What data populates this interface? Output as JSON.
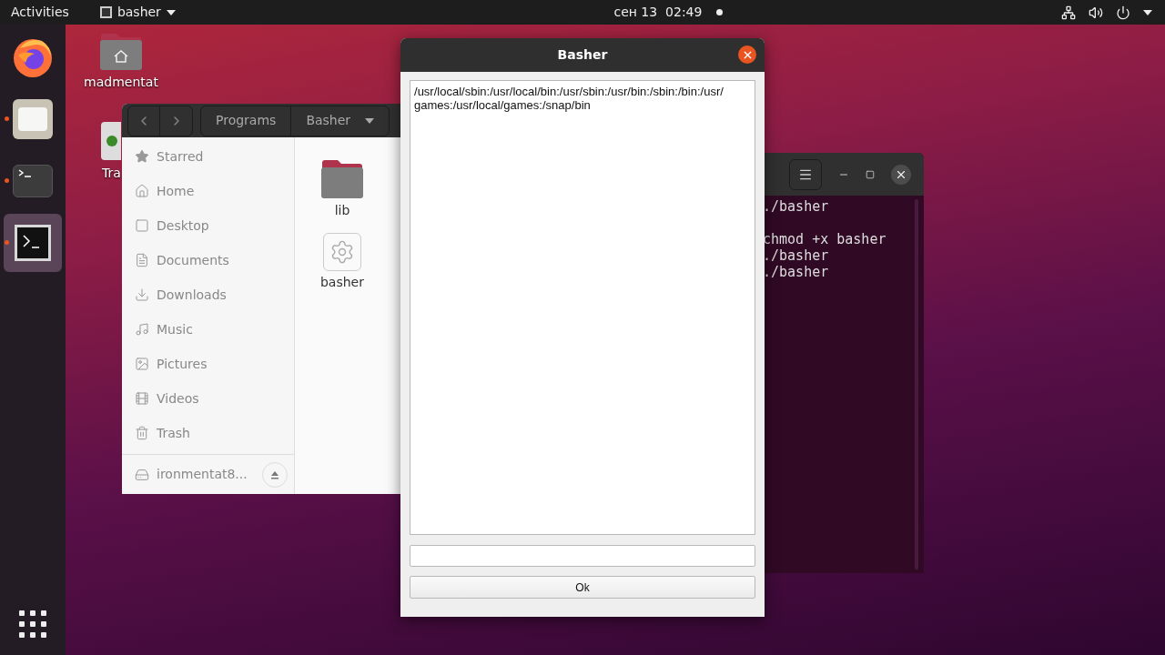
{
  "top_bar": {
    "activities": "Activities",
    "app_menu": "basher",
    "clock": "сен 13  02:49",
    "notification_dot": true
  },
  "dock": {
    "items": [
      {
        "kind": "firefox",
        "running": false,
        "active": false
      },
      {
        "kind": "files",
        "running": true,
        "active": false
      },
      {
        "kind": "terminal",
        "running": true,
        "active": false
      },
      {
        "kind": "console",
        "running": true,
        "active": true
      }
    ]
  },
  "desktop_icons": [
    {
      "kind": "home",
      "label": "madmentat"
    },
    {
      "kind": "trash",
      "label": "Tra"
    }
  ],
  "file_manager": {
    "path": [
      "Programs",
      "Basher"
    ],
    "sidebar": [
      {
        "kind": "star",
        "label": "Starred"
      },
      {
        "kind": "home",
        "label": "Home"
      },
      {
        "kind": "desktop",
        "label": "Desktop"
      },
      {
        "kind": "documents",
        "label": "Documents"
      },
      {
        "kind": "downloads",
        "label": "Downloads"
      },
      {
        "kind": "music",
        "label": "Music"
      },
      {
        "kind": "pictures",
        "label": "Pictures"
      },
      {
        "kind": "videos",
        "label": "Videos"
      },
      {
        "kind": "trash",
        "label": "Trash"
      }
    ],
    "drive": "ironmentat8...",
    "files": [
      {
        "kind": "folder",
        "name": "lib"
      },
      {
        "kind": "executable",
        "name": "basher"
      }
    ]
  },
  "terminal": {
    "lines": [
      {
        "kind": "text",
        "text": "./basher"
      },
      {
        "kind": "blank"
      },
      {
        "kind": "text",
        "text": "chmod +x basher"
      },
      {
        "kind": "text",
        "text": "./basher"
      },
      {
        "kind": "text",
        "text": "./basher"
      }
    ]
  },
  "dialog": {
    "title": "Basher",
    "output": "/usr/local/sbin:/usr/local/bin:/usr/sbin:/usr/bin:/sbin:/bin:/usr/games:/usr/local/games:/snap/bin",
    "ok": "Ok"
  }
}
